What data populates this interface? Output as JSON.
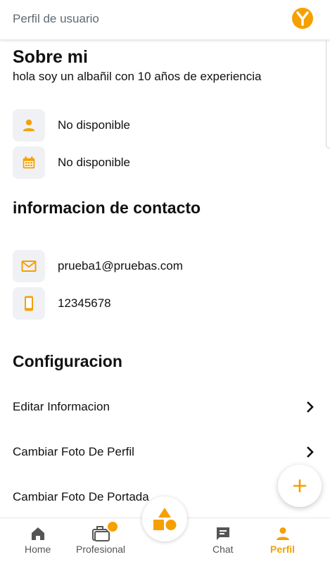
{
  "header": {
    "title": "Perfil de usuario",
    "logo_icon": "y-logo-icon"
  },
  "about": {
    "title": "Sobre mi",
    "description": "hola soy un albañil con 10 años de experiencia",
    "items": [
      {
        "icon": "person-icon",
        "value": "No disponible"
      },
      {
        "icon": "calendar-icon",
        "value": "No disponible"
      }
    ]
  },
  "contact": {
    "title": "informacion de contacto",
    "items": [
      {
        "icon": "mail-icon",
        "value": "prueba1@pruebas.com"
      },
      {
        "icon": "phone-icon",
        "value": "12345678"
      }
    ]
  },
  "config": {
    "title": "Configuracion",
    "items": [
      {
        "label": "Editar Informacion"
      },
      {
        "label": "Cambiar Foto De Perfil"
      },
      {
        "label": "Cambiar Foto De Portada"
      }
    ]
  },
  "fab": {
    "icon": "plus-icon"
  },
  "bottom_nav": {
    "items": [
      {
        "label": "Home",
        "icon": "home-icon"
      },
      {
        "label": "Profesional",
        "icon": "briefcase-icon",
        "badge": "·"
      },
      {
        "label": "Chat",
        "icon": "chat-icon"
      },
      {
        "label": "Perfil",
        "icon": "person-icon",
        "active": true
      }
    ],
    "center_icon": "shapes-icon"
  },
  "colors": {
    "accent": "#f5a000",
    "icon_bg": "#f0f1f5",
    "text": "#111111",
    "muted": "#5f6a73"
  }
}
